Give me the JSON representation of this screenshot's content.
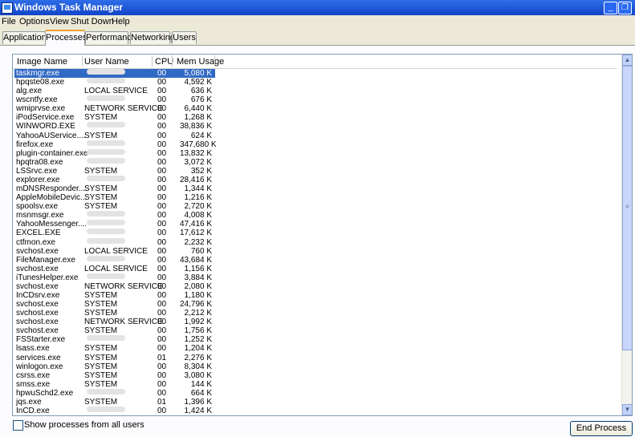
{
  "window": {
    "title": "Windows Task Manager",
    "minimize": "_",
    "maximize": "❐"
  },
  "menu": [
    "File",
    "Options",
    "View",
    "Shut Down",
    "Help"
  ],
  "tabs": [
    "Applications",
    "Processes",
    "Performance",
    "Networking",
    "Users"
  ],
  "active_tab": "Processes",
  "columns": {
    "name": "Image Name",
    "user": "User Name",
    "cpu": "CPU",
    "mem": "Mem Usage"
  },
  "processes": [
    {
      "name": "taskmgr.exe",
      "user": "",
      "cpu": "00",
      "mem": "5,080 K",
      "selected": true
    },
    {
      "name": "hpqste08.exe",
      "user": "",
      "cpu": "00",
      "mem": "4,592 K"
    },
    {
      "name": "alg.exe",
      "user": "LOCAL SERVICE",
      "cpu": "00",
      "mem": "636 K"
    },
    {
      "name": "wscntfy.exe",
      "user": "",
      "cpu": "00",
      "mem": "676 K"
    },
    {
      "name": "wmiprvse.exe",
      "user": "NETWORK SERVICE",
      "cpu": "00",
      "mem": "6,440 K"
    },
    {
      "name": "iPodService.exe",
      "user": "SYSTEM",
      "cpu": "00",
      "mem": "1,268 K"
    },
    {
      "name": "WINWORD.EXE",
      "user": "",
      "cpu": "00",
      "mem": "38,836 K"
    },
    {
      "name": "YahooAUService....",
      "user": "SYSTEM",
      "cpu": "00",
      "mem": "624 K"
    },
    {
      "name": "firefox.exe",
      "user": "",
      "cpu": "00",
      "mem": "347,680 K"
    },
    {
      "name": "plugin-container.exe",
      "user": "",
      "cpu": "00",
      "mem": "13,832 K"
    },
    {
      "name": "hpqtra08.exe",
      "user": "",
      "cpu": "00",
      "mem": "3,072 K"
    },
    {
      "name": "LSSrvc.exe",
      "user": "SYSTEM",
      "cpu": "00",
      "mem": "352 K"
    },
    {
      "name": "explorer.exe",
      "user": "",
      "cpu": "00",
      "mem": "28,416 K"
    },
    {
      "name": "mDNSResponder....",
      "user": "SYSTEM",
      "cpu": "00",
      "mem": "1,344 K"
    },
    {
      "name": "AppleMobileDevic...",
      "user": "SYSTEM",
      "cpu": "00",
      "mem": "1,216 K"
    },
    {
      "name": "spoolsv.exe",
      "user": "SYSTEM",
      "cpu": "00",
      "mem": "2,720 K"
    },
    {
      "name": "msnmsgr.exe",
      "user": "",
      "cpu": "00",
      "mem": "4,008 K"
    },
    {
      "name": "YahooMessenger....",
      "user": "",
      "cpu": "00",
      "mem": "47,416 K"
    },
    {
      "name": "EXCEL.EXE",
      "user": "",
      "cpu": "00",
      "mem": "17,612 K"
    },
    {
      "name": "ctfmon.exe",
      "user": "",
      "cpu": "00",
      "mem": "2,232 K"
    },
    {
      "name": "svchost.exe",
      "user": "LOCAL SERVICE",
      "cpu": "00",
      "mem": "760 K"
    },
    {
      "name": "FileManager.exe",
      "user": "",
      "cpu": "00",
      "mem": "43,684 K"
    },
    {
      "name": "svchost.exe",
      "user": "LOCAL SERVICE",
      "cpu": "00",
      "mem": "1,156 K"
    },
    {
      "name": "iTunesHelper.exe",
      "user": "",
      "cpu": "00",
      "mem": "3,884 K"
    },
    {
      "name": "svchost.exe",
      "user": "NETWORK SERVICE",
      "cpu": "00",
      "mem": "2,080 K"
    },
    {
      "name": "InCDsrv.exe",
      "user": "SYSTEM",
      "cpu": "00",
      "mem": "1,180 K"
    },
    {
      "name": "svchost.exe",
      "user": "SYSTEM",
      "cpu": "00",
      "mem": "24,796 K"
    },
    {
      "name": "svchost.exe",
      "user": "SYSTEM",
      "cpu": "00",
      "mem": "2,212 K"
    },
    {
      "name": "svchost.exe",
      "user": "NETWORK SERVICE",
      "cpu": "00",
      "mem": "1,992 K"
    },
    {
      "name": "svchost.exe",
      "user": "SYSTEM",
      "cpu": "00",
      "mem": "1,756 K"
    },
    {
      "name": "FSStarter.exe",
      "user": "",
      "cpu": "00",
      "mem": "1,252 K"
    },
    {
      "name": "lsass.exe",
      "user": "SYSTEM",
      "cpu": "00",
      "mem": "1,204 K"
    },
    {
      "name": "services.exe",
      "user": "SYSTEM",
      "cpu": "01",
      "mem": "2,276 K"
    },
    {
      "name": "winlogon.exe",
      "user": "SYSTEM",
      "cpu": "00",
      "mem": "8,304 K"
    },
    {
      "name": "csrss.exe",
      "user": "SYSTEM",
      "cpu": "00",
      "mem": "3,080 K"
    },
    {
      "name": "smss.exe",
      "user": "SYSTEM",
      "cpu": "00",
      "mem": "144 K"
    },
    {
      "name": "hpwuSchd2.exe",
      "user": "",
      "cpu": "00",
      "mem": "664 K"
    },
    {
      "name": "jqs.exe",
      "user": "SYSTEM",
      "cpu": "01",
      "mem": "1,396 K"
    },
    {
      "name": "InCD.exe",
      "user": "",
      "cpu": "00",
      "mem": "1,424 K"
    }
  ],
  "show_all_label": "Show processes from all users",
  "end_process_label": "End Process",
  "colors": {
    "title_bar": "#1f5ee0",
    "selection": "#316ac5",
    "tab_highlight": "#f0a030"
  }
}
